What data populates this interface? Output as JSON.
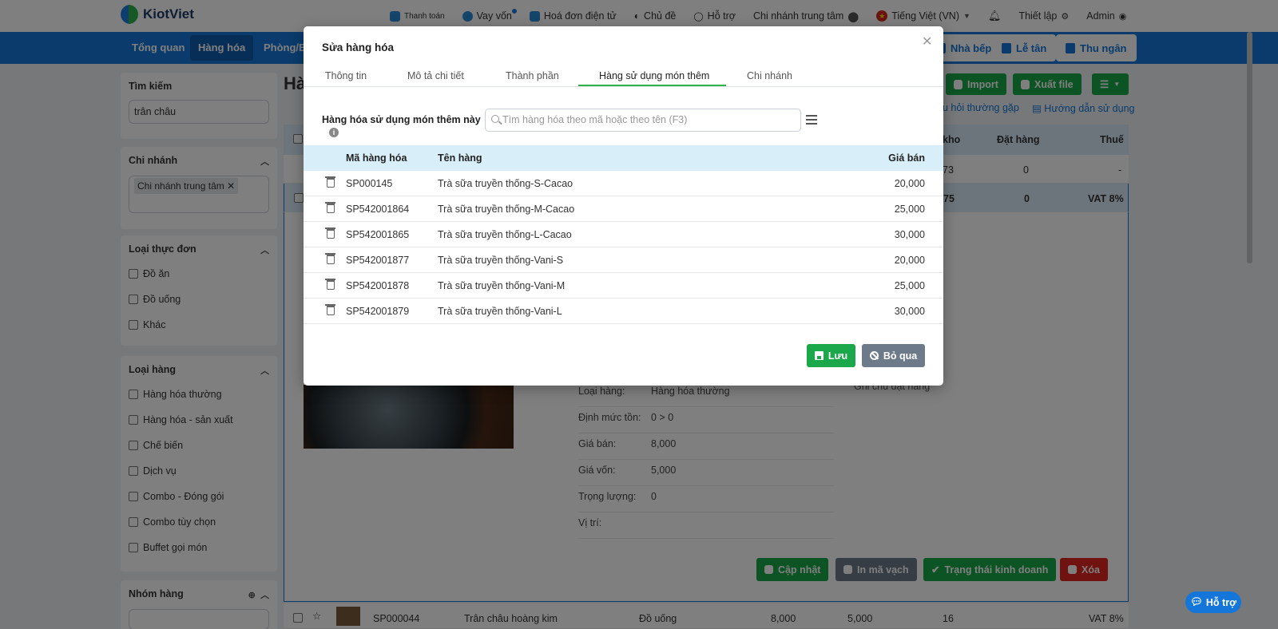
{
  "topbar": {
    "brand": "KiotViet",
    "links": {
      "payment": "Thanh toán",
      "loan": "Vay vốn",
      "einvoice": "Hoá đơn điện tử",
      "theme": "Chủ đề",
      "support": "Hỗ trợ",
      "branch": "Chi nhánh trung tâm",
      "language": "Tiếng Việt (VN)",
      "settings": "Thiết lập",
      "user": "Admin"
    }
  },
  "nav": {
    "items": [
      "Tổng quan",
      "Hàng hóa",
      "Phòng/Bàn"
    ],
    "right": {
      "kitchen": "Nhà bếp",
      "reception": "Lễ tân",
      "cashier": "Thu ngân"
    }
  },
  "sidebar": {
    "search": {
      "title": "Tìm kiếm",
      "value": "trân châu"
    },
    "branch": {
      "title": "Chi nhánh",
      "tag": "Chi nhánh trung tâm"
    },
    "menu_type": {
      "title": "Loại thực đơn",
      "options": [
        "Đồ ăn",
        "Đồ uống",
        "Khác"
      ]
    },
    "product_type": {
      "title": "Loại hàng",
      "options": [
        "Hàng hóa thường",
        "Hàng hóa - sản xuất",
        "Chế biến",
        "Dịch vụ",
        "Combo - Đóng gói",
        "Combo tùy chọn",
        "Buffet gọi món"
      ]
    },
    "group": {
      "title": "Nhóm hàng"
    }
  },
  "page": {
    "title": "Hà",
    "buttons": {
      "import": "Import",
      "export": "Xuất file"
    },
    "help": {
      "faq": "u hỏi thường gặp",
      "guide": "Hướng dẫn sử dụng"
    },
    "table_head": {
      "stock": "kho",
      "ordered": "Đặt hàng",
      "tax": "Thuế"
    },
    "rows": [
      {
        "stock": "73",
        "ordered": "0",
        "tax": "-"
      },
      {
        "stock": "75",
        "ordered": "0",
        "tax": "VAT 8%"
      }
    ],
    "detail": {
      "note_label": "Ghi chú đặt hàng",
      "fields": [
        {
          "k": "Loại hàng:",
          "v": "Hàng hóa thường"
        },
        {
          "k": "Định mức tồn:",
          "v": "0  >  0"
        },
        {
          "k": "Giá bán:",
          "v": "8,000"
        },
        {
          "k": "Giá vốn:",
          "v": "5,000"
        },
        {
          "k": "Trọng lượng:",
          "v": "0"
        },
        {
          "k": "Vị trí:",
          "v": ""
        }
      ],
      "actions": {
        "update": "Cập nhật",
        "print": "In mã vạch",
        "status": "Trạng thái kinh doanh",
        "delete": "Xóa"
      }
    },
    "bottom_row": {
      "code": "SP000044",
      "name": "Trân châu hoàng kim",
      "type": "Đồ uống",
      "price": "8,000",
      "cost": "5,000",
      "stock": "16",
      "tax": "VAT 8%"
    }
  },
  "chat": {
    "label": "Hỗ trợ"
  },
  "modal": {
    "title": "Sửa hàng hóa",
    "tabs": [
      "Thông tin",
      "Mô tả chi tiết",
      "Thành phần",
      "Hàng sử dụng món thêm",
      "Chi nhánh"
    ],
    "active_tab": 3,
    "used_label": "Hàng hóa sử dụng món thêm này",
    "search_placeholder": "Tìm hàng hóa theo mã hoặc theo tên (F3)",
    "columns": {
      "code": "Mã hàng hóa",
      "name": "Tên hàng",
      "price": "Giá bán"
    },
    "rows": [
      {
        "code": "SP000145",
        "name": "Trà sữa truyền thống-S-Cacao",
        "price": "20,000"
      },
      {
        "code": "SP542001864",
        "name": "Trà sữa truyền thống-M-Cacao",
        "price": "25,000"
      },
      {
        "code": "SP542001865",
        "name": "Trà sữa truyền thống-L-Cacao",
        "price": "30,000"
      },
      {
        "code": "SP542001877",
        "name": "Trà sữa truyền thống-Vani-S",
        "price": "20,000"
      },
      {
        "code": "SP542001878",
        "name": "Trà sữa truyền thống-Vani-M",
        "price": "25,000"
      },
      {
        "code": "SP542001879",
        "name": "Trà sữa truyền thống-Vani-L",
        "price": "30,000"
      }
    ],
    "save": "Lưu",
    "skip": "Bỏ qua"
  },
  "colors": {
    "primary": "#1476d8",
    "success": "#1aa84a",
    "danger": "#e0251f",
    "muted": "#6c7a8a"
  }
}
